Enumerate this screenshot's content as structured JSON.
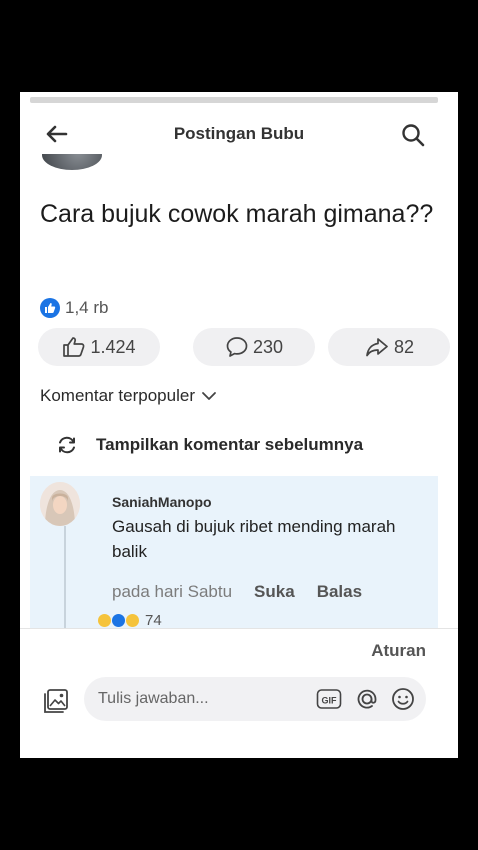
{
  "header": {
    "title": "Postingan Bubu",
    "back_icon": "arrow-left-icon",
    "search_icon": "search-icon"
  },
  "post": {
    "text": "Cara bujuk cowok marah gimana??",
    "reaction_count": "1,4 rb",
    "like_count": "1.424",
    "comment_count": "230",
    "share_count": "82"
  },
  "comments": {
    "sort_label": "Komentar terpopuler",
    "show_previous_label": "Tampilkan komentar sebelumnya",
    "items": [
      {
        "author": "SaniahManopo",
        "text": "Gausah di bujuk ribet mending marah balik",
        "time": "pada hari Sabtu",
        "like_action": "Suka",
        "reply_action": "Balas",
        "reaction_count": "74"
      }
    ]
  },
  "footer": {
    "rules_label": "Aturan",
    "reply_placeholder": "Tulis jawaban..."
  },
  "colors": {
    "accent": "#1b74e4",
    "comment_highlight": "#e9f3fb"
  }
}
